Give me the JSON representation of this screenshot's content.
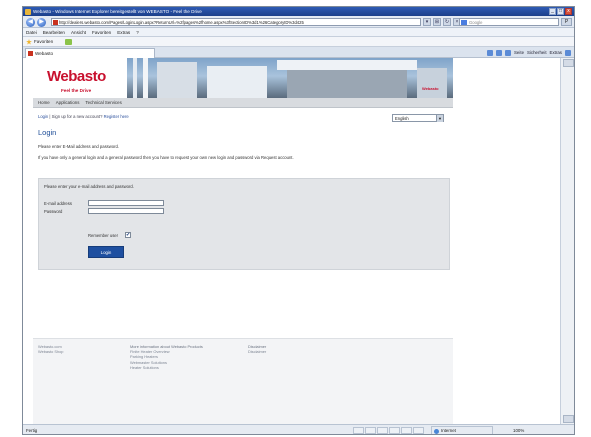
{
  "window": {
    "title": "Webasto - Windows Internet Explorer bereitgestellt von WEBASTO - Feel the Drive",
    "min": "_",
    "max": "□",
    "close": "x"
  },
  "addressbar": {
    "back": "◀",
    "forward": "▶",
    "url": "http://dealers.webasto.com/Pages/LoginLogin.aspx?ReturnUrl=%2fpages%2fhome.aspx%3fSectionID%3d1%26CategoryID%3d425",
    "search_placeholder": "Google",
    "search_go": "P"
  },
  "menubar": {
    "items": [
      "Datei",
      "Bearbeiten",
      "Ansicht",
      "Favoriten",
      "Extras",
      "?"
    ]
  },
  "favorites": {
    "label": "Favoriten"
  },
  "tabs": {
    "active": "Webasto"
  },
  "commandbar": {
    "items": [
      "Seite",
      "Sicherheit",
      "Extras"
    ]
  },
  "site": {
    "brand": "Webasto",
    "tagline": "Feel the Drive",
    "banner_brand": "Webasto",
    "nav": [
      "Home",
      "Applications",
      "Technical Services"
    ],
    "breadcrumb": {
      "login": "Login",
      "prompt": "Sign up for a new account?",
      "register": "Register here"
    },
    "language": "English",
    "language_arrow": "▼",
    "title": "Login",
    "intro1": "Please enter E-Mail address and password.",
    "intro2": "If you have only a general login and a general password then you have to request your own new login and password via Request account.",
    "form": {
      "hint": "Please enter your e-mail address and password.",
      "email_label": "E-mail address",
      "password_label": "Password",
      "remember_label": "Remember user",
      "remember_check": "✔",
      "submit": "Login"
    },
    "footer": {
      "col1": [
        "Webasto.com",
        "Webasto Shop"
      ],
      "col2": [
        "More information about Webasto Products",
        "Finite Heater Overview",
        "Parking Heaters",
        "Webmaster Solutions",
        "Heater Solutions"
      ],
      "col3": [
        "Disclaimer",
        "Disclaimer"
      ]
    }
  },
  "statusbar": {
    "left": "Fertig",
    "zone": "Internet",
    "zoom": "100%"
  }
}
